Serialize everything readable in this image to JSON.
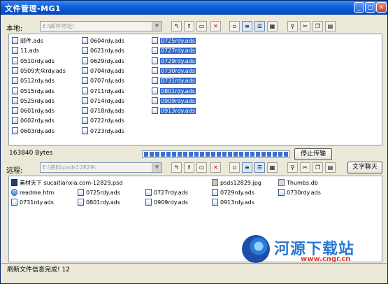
{
  "window": {
    "title": "文件管理-MG1"
  },
  "local": {
    "label": "本地:",
    "path": "E:\\邮件地址\\",
    "files": [
      {
        "name": "邮件.ads",
        "sel": false
      },
      {
        "name": "11.ads",
        "sel": false
      },
      {
        "name": "0510rdy.ads",
        "sel": false
      },
      {
        "name": "0509大众rdy.ads",
        "sel": false
      },
      {
        "name": "0512rdy.ads",
        "sel": false
      },
      {
        "name": "0515rdy.ads",
        "sel": false
      },
      {
        "name": "0525rdy.ads",
        "sel": false
      },
      {
        "name": "0601rdy.ads",
        "sel": false
      },
      {
        "name": "0602rdy.ads",
        "sel": false
      },
      {
        "name": "0603rdy.ads",
        "sel": false
      },
      {
        "name": "0604rdy.ads",
        "sel": false
      },
      {
        "name": "0621rdy.ads",
        "sel": false
      },
      {
        "name": "0629rdy.ads",
        "sel": false
      },
      {
        "name": "0704rdy.ads",
        "sel": false
      },
      {
        "name": "0707rdy.ads",
        "sel": false
      },
      {
        "name": "0711rdy.ads",
        "sel": false
      },
      {
        "name": "0714rdy.ads",
        "sel": false
      },
      {
        "name": "0718rdy.ads",
        "sel": false
      },
      {
        "name": "0722rdy.ads",
        "sel": false
      },
      {
        "name": "0723rdy.ads",
        "sel": false
      },
      {
        "name": "0725rdy.ads",
        "sel": true
      },
      {
        "name": "0727rdy.ads",
        "sel": true
      },
      {
        "name": "0729rdy.ads",
        "sel": true
      },
      {
        "name": "0730rdy.ads",
        "sel": true
      },
      {
        "name": "0731rdy.ads",
        "sel": true
      },
      {
        "name": "0801rdy.ads",
        "sel": true
      },
      {
        "name": "0909rdy.ads",
        "sel": true
      },
      {
        "name": "0913rdy.ads",
        "sel": true
      }
    ]
  },
  "transfer": {
    "bytes": "163840 Bytes",
    "progress": 1.0,
    "stop_label": "停止传输"
  },
  "remote": {
    "label": "远程:",
    "path": "E:\\资料\\psds12829\\",
    "chat_label": "文字聊天",
    "files": [
      {
        "name": "素材天下 sucaitianxia.com-12829.psd",
        "icon": "psd"
      },
      {
        "name": "psds12829.jpg",
        "icon": "jpg"
      },
      {
        "name": "Thumbs.db",
        "icon": "db"
      },
      {
        "name": "readme.htm",
        "icon": "htm"
      },
      {
        "name": "0725rdy.ads",
        "icon": "ads"
      },
      {
        "name": "0727rdy.ads",
        "icon": "ads"
      },
      {
        "name": "0729rdy.ads",
        "icon": "ads"
      },
      {
        "name": "0730rdy.ads",
        "icon": "ads"
      },
      {
        "name": "0731rdy.ads",
        "icon": "ads"
      },
      {
        "name": "0801rdy.ads",
        "icon": "ads"
      },
      {
        "name": "0909rdy.ads",
        "icon": "ads"
      },
      {
        "name": "0913rdy.ads",
        "icon": "ads"
      }
    ]
  },
  "toolbar": {
    "icons": [
      "folder-up-icon",
      "folder-up2-icon",
      "new-folder-icon",
      "delete-icon",
      "small-icons-view-icon",
      "list-view-icon",
      "details-view-icon",
      "large-view-icon",
      "find-icon",
      "cut-icon",
      "copy-icon",
      "paste-icon"
    ]
  },
  "status": {
    "text": "刷新文件信息完成! 12"
  },
  "watermark": {
    "name": "河源下载站",
    "url": "www.cngr.cn"
  },
  "colors": {
    "titlebar": "#0A5FD8",
    "selection": "#3169C6",
    "progress": "#3C6FD1",
    "watermark_text": "#2B78D3",
    "watermark_url": "#D83B2E"
  }
}
